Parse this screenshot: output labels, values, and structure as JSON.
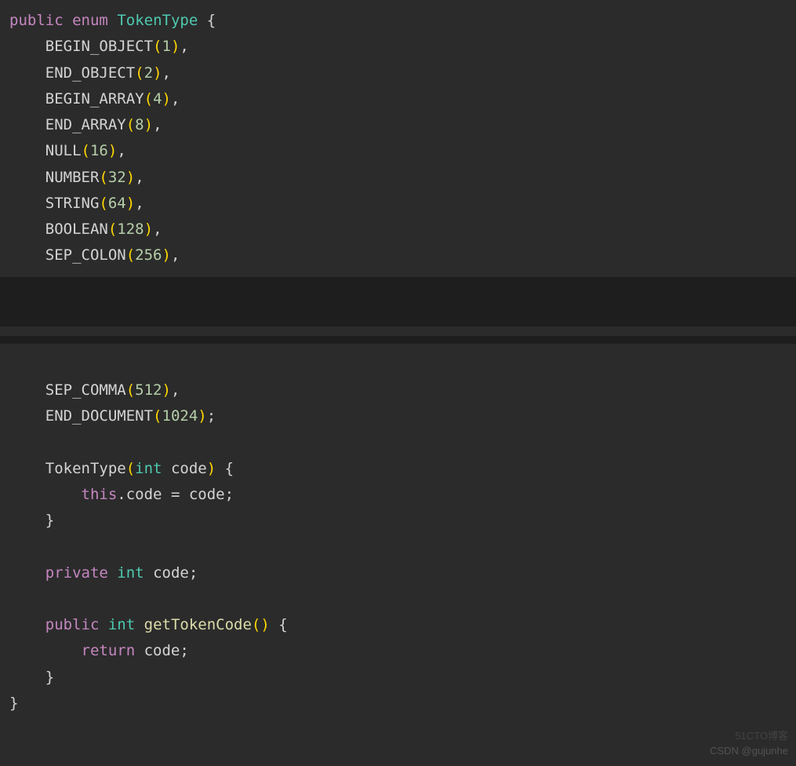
{
  "code": {
    "kw_public": "public",
    "kw_enum": "enum",
    "kw_private": "private",
    "kw_return": "return",
    "kw_this": "this",
    "type_int": "int",
    "class_name": "TokenType",
    "ctor_name": "TokenType",
    "ctor_param": "code",
    "field_name": "code",
    "method_name": "getTokenCode",
    "enum_values": [
      {
        "name": "BEGIN_OBJECT",
        "value": "1"
      },
      {
        "name": "END_OBJECT",
        "value": "2"
      },
      {
        "name": "BEGIN_ARRAY",
        "value": "4"
      },
      {
        "name": "END_ARRAY",
        "value": "8"
      },
      {
        "name": "NULL",
        "value": "16"
      },
      {
        "name": "NUMBER",
        "value": "32"
      },
      {
        "name": "STRING",
        "value": "64"
      },
      {
        "name": "BOOLEAN",
        "value": "128"
      },
      {
        "name": "SEP_COLON",
        "value": "256"
      },
      {
        "name": "SEP_COMMA",
        "value": "512"
      },
      {
        "name": "END_DOCUMENT",
        "value": "1024"
      }
    ]
  },
  "watermarks": {
    "w1": "51CTO博客",
    "w2": "CSDN @gujunhe"
  }
}
